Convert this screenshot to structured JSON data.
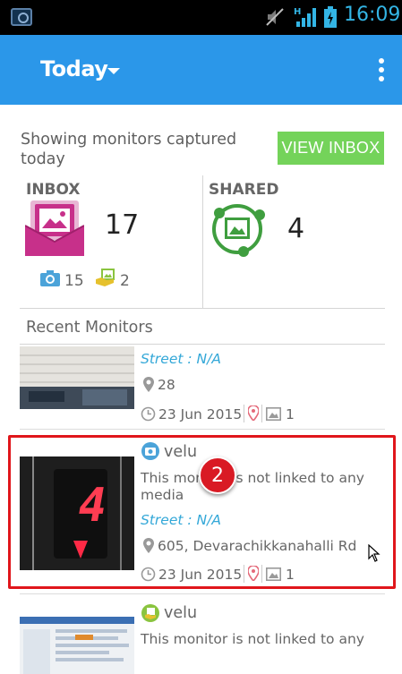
{
  "status_bar": {
    "time": "16:09"
  },
  "app_bar": {
    "title": "Today"
  },
  "summary": {
    "showing_text": "Showing monitors captured today",
    "view_inbox_label": "VIEW INBOX",
    "inbox": {
      "label": "INBOX",
      "count": "17",
      "photo_count": "15",
      "image_count": "2"
    },
    "shared": {
      "label": "SHARED",
      "count": "4"
    }
  },
  "recent": {
    "label": "Recent Monitors",
    "items": [
      {
        "street": "Street : N/A",
        "location": "28",
        "date": "23 Jun 2015",
        "images": "1"
      },
      {
        "user": "velu",
        "description": "This monitor is not linked to any media",
        "street": "Street : N/A",
        "location": "605, Devarachikkanahalli Rd",
        "date": "23 Jun 2015",
        "images": "1"
      },
      {
        "user": "velu",
        "description": "This monitor is not linked to any"
      }
    ]
  },
  "annotation": {
    "badge": "2"
  },
  "colors": {
    "app_bar": "#2b97e9",
    "accent_green": "#74d35a",
    "street_blue": "#34a8d8",
    "highlight_red": "#e0161b",
    "inbox_pink": "#c7308a",
    "shared_green": "#3f9e3f"
  }
}
